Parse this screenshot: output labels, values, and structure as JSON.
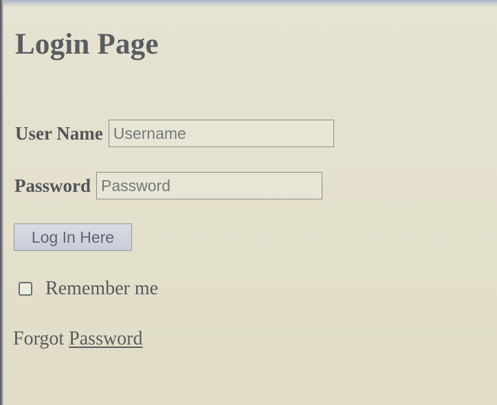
{
  "page": {
    "title": "Login Page"
  },
  "form": {
    "username": {
      "label": "User Name",
      "placeholder": "Username",
      "value": ""
    },
    "password": {
      "label": "Password",
      "placeholder": "Password",
      "value": ""
    },
    "submit_label": "Log In Here",
    "remember": {
      "label": "Remember me",
      "checked": false
    },
    "forgot": {
      "prefix": "Forgot",
      "link_text": "Password"
    }
  },
  "colors": {
    "background": "#e4e1cf",
    "text": "#55565a",
    "button_bg": "#cdd1db"
  }
}
